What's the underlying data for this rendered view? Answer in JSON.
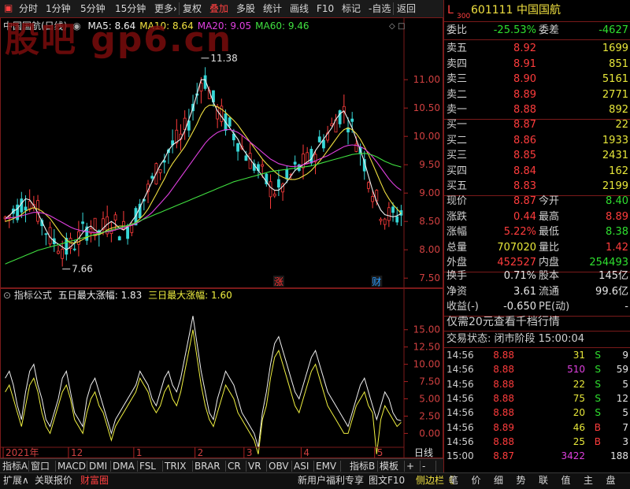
{
  "toolbar": {
    "items": [
      "分时",
      "1分钟",
      "5分钟",
      "15分钟",
      "更多›",
      "复权",
      "叠加",
      "多股",
      "统计",
      "画线",
      "F10",
      "标记",
      "-自选",
      "返回"
    ],
    "active_index": 6
  },
  "stock": {
    "code": "601111",
    "name": "中国国航",
    "level": "L",
    "level_sub": "300"
  },
  "watermark": "股吧 gp6.cn",
  "main_legend": {
    "title": "中国国航(日线)",
    "ma": [
      {
        "label": "MA5: 8.64",
        "color": "#f0f0f0"
      },
      {
        "label": "MA10: 8.64",
        "color": "#f0e040"
      },
      {
        "label": "MA20: 9.05",
        "color": "#e040e0"
      },
      {
        "label": "MA60: 9.46",
        "color": "#40e040"
      }
    ]
  },
  "indicator_legend": {
    "title": "指标公式",
    "label1": "五日最大涨幅: 1.83",
    "label2": "三日最大涨幅: 1.60"
  },
  "chart_data": [
    {
      "type": "candlestick",
      "title": "中国国航(日线)",
      "ylim": [
        7.35,
        11.85
      ],
      "yticks": [
        7.5,
        8.0,
        8.5,
        9.0,
        9.5,
        10.0,
        10.5,
        11.0
      ],
      "ytick_labels": [
        "7.50",
        "8.00",
        "8.50",
        "9.00",
        "9.50",
        "10.00",
        "10.50",
        "11.00"
      ],
      "annotations": [
        {
          "text": "11.38",
          "value": 11.38,
          "index": 48
        },
        {
          "text": "7.66",
          "value": 7.66,
          "index": 14
        }
      ],
      "markers": [
        {
          "text": "涨",
          "index": 67,
          "color": "#ff3030"
        },
        {
          "text": "财",
          "index": 91,
          "color": "#2a9cff"
        }
      ],
      "xlabels": [
        {
          "text": "2021年",
          "index": 0
        },
        {
          "text": "12",
          "index": 16
        },
        {
          "text": "1",
          "index": 32
        },
        {
          "text": "2",
          "index": 47
        },
        {
          "text": "3",
          "index": 59
        },
        {
          "text": "4",
          "index": 73
        },
        {
          "text": "5",
          "index": 91
        }
      ],
      "xlabel_right": "日线",
      "colors": {
        "up": "#ff3c3c",
        "down": "#37d7d7"
      },
      "series": [
        {
          "name": "MA5",
          "color": "#f0f0f0",
          "values": [
            8.55,
            8.6,
            8.68,
            8.72,
            8.82,
            8.9,
            8.88,
            8.78,
            8.65,
            8.5,
            8.35,
            8.22,
            8.15,
            8.1,
            8.05,
            8.0,
            8.05,
            8.12,
            8.2,
            8.3,
            8.38,
            8.42,
            8.35,
            8.3,
            8.38,
            8.45,
            8.5,
            8.45,
            8.38,
            8.35,
            8.4,
            8.5,
            8.6,
            8.75,
            8.9,
            9.05,
            9.2,
            9.35,
            9.5,
            9.6,
            9.75,
            9.85,
            9.9,
            9.95,
            10.1,
            10.3,
            10.5,
            10.75,
            11.0,
            11.0,
            10.8,
            10.6,
            10.45,
            10.35,
            10.25,
            10.15,
            10.05,
            9.95,
            9.8,
            9.7,
            9.6,
            9.5,
            9.4,
            9.3,
            9.2,
            9.1,
            9.05,
            9.05,
            9.12,
            9.2,
            9.3,
            9.4,
            9.45,
            9.5,
            9.55,
            9.6,
            9.75,
            9.85,
            9.95,
            10.05,
            10.15,
            10.3,
            10.4,
            10.45,
            10.3,
            10.15,
            9.95,
            9.75,
            9.55,
            9.3,
            9.05,
            8.85,
            8.7,
            8.62,
            8.6,
            8.58,
            8.6,
            8.64
          ]
        },
        {
          "name": "MA10",
          "color": "#f0e040",
          "values": [
            8.5,
            8.52,
            8.55,
            8.58,
            8.62,
            8.68,
            8.72,
            8.74,
            8.72,
            8.68,
            8.62,
            8.55,
            8.45,
            8.35,
            8.25,
            8.18,
            8.12,
            8.12,
            8.14,
            8.18,
            8.22,
            8.25,
            8.26,
            8.27,
            8.3,
            8.35,
            8.38,
            8.4,
            8.42,
            8.42,
            8.42,
            8.44,
            8.48,
            8.55,
            8.62,
            8.72,
            8.85,
            8.98,
            9.12,
            9.25,
            9.4,
            9.52,
            9.62,
            9.72,
            9.82,
            9.95,
            10.08,
            10.22,
            10.38,
            10.5,
            10.55,
            10.55,
            10.52,
            10.48,
            10.42,
            10.35,
            10.28,
            10.2,
            10.1,
            10.0,
            9.9,
            9.8,
            9.7,
            9.6,
            9.52,
            9.45,
            9.38,
            9.32,
            9.28,
            9.25,
            9.24,
            9.24,
            9.26,
            9.3,
            9.34,
            9.4,
            9.48,
            9.56,
            9.65,
            9.75,
            9.85,
            9.95,
            10.05,
            10.12,
            10.15,
            10.12,
            10.05,
            9.95,
            9.82,
            9.68,
            9.52,
            9.35,
            9.18,
            9.02,
            8.9,
            8.8,
            8.72,
            8.64
          ]
        },
        {
          "name": "MA20",
          "color": "#e040e0",
          "values": [
            8.55,
            8.56,
            8.57,
            8.58,
            8.6,
            8.62,
            8.64,
            8.66,
            8.66,
            8.65,
            8.63,
            8.6,
            8.56,
            8.52,
            8.48,
            8.44,
            8.4,
            8.37,
            8.35,
            8.33,
            8.32,
            8.31,
            8.3,
            8.3,
            8.31,
            8.32,
            8.33,
            8.35,
            8.37,
            8.39,
            8.41,
            8.43,
            8.46,
            8.5,
            8.55,
            8.6,
            8.66,
            8.74,
            8.82,
            8.9,
            8.98,
            9.08,
            9.18,
            9.28,
            9.38,
            9.48,
            9.58,
            9.68,
            9.78,
            9.88,
            9.96,
            10.02,
            10.07,
            10.1,
            10.12,
            10.12,
            10.1,
            10.07,
            10.02,
            9.96,
            9.9,
            9.84,
            9.78,
            9.72,
            9.66,
            9.6,
            9.56,
            9.52,
            9.5,
            9.48,
            9.47,
            9.47,
            9.48,
            9.5,
            9.52,
            9.54,
            9.57,
            9.6,
            9.63,
            9.66,
            9.7,
            9.74,
            9.78,
            9.82,
            9.84,
            9.85,
            9.84,
            9.82,
            9.78,
            9.72,
            9.64,
            9.55,
            9.45,
            9.35,
            9.25,
            9.17,
            9.1,
            9.05
          ]
        },
        {
          "name": "MA60",
          "color": "#40e040",
          "values": [
            7.75,
            7.78,
            7.81,
            7.84,
            7.87,
            7.9,
            7.93,
            7.96,
            7.99,
            8.01,
            8.03,
            8.05,
            8.07,
            8.09,
            8.11,
            8.13,
            8.15,
            8.17,
            8.19,
            8.21,
            8.23,
            8.25,
            8.27,
            8.29,
            8.31,
            8.33,
            8.35,
            8.37,
            8.39,
            8.41,
            8.43,
            8.45,
            8.48,
            8.51,
            8.54,
            8.57,
            8.6,
            8.63,
            8.66,
            8.69,
            8.72,
            8.75,
            8.78,
            8.81,
            8.84,
            8.87,
            8.9,
            8.93,
            8.96,
            8.99,
            9.02,
            9.05,
            9.08,
            9.11,
            9.14,
            9.17,
            9.2,
            9.22,
            9.24,
            9.26,
            9.28,
            9.3,
            9.32,
            9.34,
            9.36,
            9.38,
            9.39,
            9.4,
            9.41,
            9.42,
            9.43,
            9.44,
            9.45,
            9.46,
            9.47,
            9.48,
            9.5,
            9.52,
            9.54,
            9.56,
            9.58,
            9.6,
            9.62,
            9.64,
            9.66,
            9.68,
            9.69,
            9.7,
            9.7,
            9.69,
            9.67,
            9.64,
            9.6,
            9.56,
            9.53,
            9.5,
            9.48,
            9.46
          ]
        }
      ]
    },
    {
      "type": "line",
      "title": "指标公式",
      "ylim": [
        -3.6,
        18.5
      ],
      "yticks": [
        0.0,
        2.5,
        5.0,
        7.5,
        10.0,
        12.5,
        15.0
      ],
      "ytick_labels": [
        "0.00",
        "2.50",
        "5.00",
        "7.50",
        "10.00",
        "12.50",
        "15.00"
      ],
      "series": [
        {
          "name": "五日最大涨幅",
          "color": "#f0f0f0",
          "values": [
            8,
            9,
            7,
            4,
            2,
            6,
            9,
            10,
            7,
            5,
            2,
            1,
            3,
            5,
            8,
            9,
            6,
            3,
            2,
            1,
            5,
            7,
            8,
            6,
            4,
            2,
            0,
            2,
            3,
            4,
            5,
            6,
            7,
            9,
            8,
            7,
            5,
            4,
            6,
            8,
            9,
            7,
            6,
            8,
            11,
            14,
            17,
            13,
            9,
            6,
            3,
            2,
            5,
            7,
            9,
            8,
            7,
            5,
            3,
            2,
            1,
            0,
            -2,
            3,
            6,
            10,
            13,
            14,
            12,
            10,
            8,
            6,
            5,
            7,
            9,
            11,
            12,
            10,
            8,
            6,
            5,
            4,
            3,
            2,
            1,
            3,
            5,
            7,
            8,
            6,
            4,
            2,
            4,
            6,
            5,
            3,
            2,
            1.83
          ]
        },
        {
          "name": "三日最大涨幅",
          "color": "#f0f040",
          "values": [
            6,
            7,
            5,
            3,
            1,
            4,
            7,
            8,
            6,
            3,
            1,
            0,
            2,
            4,
            6,
            7,
            5,
            2,
            1,
            0,
            3,
            5,
            6,
            4,
            3,
            1,
            -1,
            1,
            2,
            3,
            4,
            5,
            6,
            8,
            7,
            6,
            4,
            3,
            4,
            6,
            7,
            5,
            4,
            6,
            9,
            12,
            15,
            11,
            7,
            4,
            2,
            1,
            3,
            5,
            7,
            6,
            5,
            3,
            2,
            1,
            0,
            -1,
            -3,
            2,
            4,
            8,
            11,
            12,
            10,
            8,
            6,
            4,
            3,
            5,
            7,
            9,
            10,
            8,
            6,
            4,
            3,
            2,
            1,
            0,
            0,
            2,
            4,
            5,
            6,
            4,
            3,
            -3,
            2,
            4,
            3,
            2,
            1,
            1.6
          ]
        }
      ]
    }
  ],
  "quote": {
    "webi_label": "委比",
    "webi_value": "-25.53%",
    "wecha_label": "委差",
    "wecha_value": "-4627",
    "sell": [
      {
        "label": "卖五",
        "price": "8.92",
        "vol": "1699"
      },
      {
        "label": "卖四",
        "price": "8.91",
        "vol": "851"
      },
      {
        "label": "卖三",
        "price": "8.90",
        "vol": "5161"
      },
      {
        "label": "卖二",
        "price": "8.89",
        "vol": "2771"
      },
      {
        "label": "卖一",
        "price": "8.88",
        "vol": "892"
      }
    ],
    "buy": [
      {
        "label": "买一",
        "price": "8.87",
        "vol": "22"
      },
      {
        "label": "买二",
        "price": "8.86",
        "vol": "1933"
      },
      {
        "label": "买三",
        "price": "8.85",
        "vol": "2431"
      },
      {
        "label": "买四",
        "price": "8.84",
        "vol": "162"
      },
      {
        "label": "买五",
        "price": "8.83",
        "vol": "2199"
      }
    ],
    "stats": [
      {
        "l1": "现价",
        "v1": "8.87",
        "c1": "red",
        "l2": "今开",
        "v2": "8.40",
        "c2": "grn"
      },
      {
        "l1": "涨跌",
        "v1": "0.44",
        "c1": "red",
        "l2": "最高",
        "v2": "8.89",
        "c2": "red"
      },
      {
        "l1": "涨幅",
        "v1": "5.22%",
        "c1": "red",
        "l2": "最低",
        "v2": "8.38",
        "c2": "grn"
      },
      {
        "l1": "总量",
        "v1": "707020",
        "c1": "yel",
        "l2": "量比",
        "v2": "1.42",
        "c2": "red"
      },
      {
        "l1": "外盘",
        "v1": "452527",
        "c1": "red",
        "l2": "内盘",
        "v2": "254493",
        "c2": "grn"
      }
    ],
    "fin": [
      {
        "l1": "换手",
        "v1": "0.71%",
        "l2": "股本",
        "v2": "145亿"
      },
      {
        "l1": "净资",
        "v1": "3.61",
        "l2": "流通",
        "v2": "99.6亿"
      },
      {
        "l1": "收益(-)",
        "v1": "-0.650",
        "l2": "PE(动)",
        "v2": "-"
      }
    ],
    "promo": "仅需20元查看千档行情",
    "status": "交易状态: 闭市阶段 15:00:04",
    "ticks": [
      {
        "time": "14:56",
        "price": "8.88",
        "vol": "31",
        "bs": "S",
        "n": "9",
        "vc": "yel"
      },
      {
        "time": "14:56",
        "price": "8.88",
        "vol": "510",
        "bs": "S",
        "n": "59",
        "vc": "mag"
      },
      {
        "time": "14:56",
        "price": "8.88",
        "vol": "22",
        "bs": "S",
        "n": "5",
        "vc": "yel"
      },
      {
        "time": "14:56",
        "price": "8.88",
        "vol": "75",
        "bs": "S",
        "n": "12",
        "vc": "yel"
      },
      {
        "time": "14:56",
        "price": "8.88",
        "vol": "20",
        "bs": "S",
        "n": "5",
        "vc": "yel"
      },
      {
        "time": "14:56",
        "price": "8.89",
        "vol": "46",
        "bs": "B",
        "n": "7",
        "vc": "yel"
      },
      {
        "time": "14:56",
        "price": "8.88",
        "vol": "25",
        "bs": "B",
        "n": "3",
        "vc": "yel"
      },
      {
        "time": "15:00",
        "price": "8.87",
        "vol": "3422",
        "bs": "",
        "n": "188",
        "vc": "mag"
      }
    ]
  },
  "bottom_tabs": [
    "指标A",
    "窗口",
    "MACD",
    "DMI",
    "DMA",
    "FSL",
    "TRIX",
    "BRAR",
    "CR",
    "VR",
    "OBV",
    "ASI",
    "EMV",
    "指标B",
    "模板",
    "+",
    "-"
  ],
  "bottom_bar2_left": [
    "扩展∧",
    "关联报价",
    "财富圈"
  ],
  "bottom_bar2_mid": [
    "新用户福利专享",
    "图文F10",
    "侧边栏《"
  ],
  "bottom_bar2_right": [
    "笔",
    "价",
    "细",
    "势",
    "联",
    "值",
    "主",
    "盘"
  ]
}
